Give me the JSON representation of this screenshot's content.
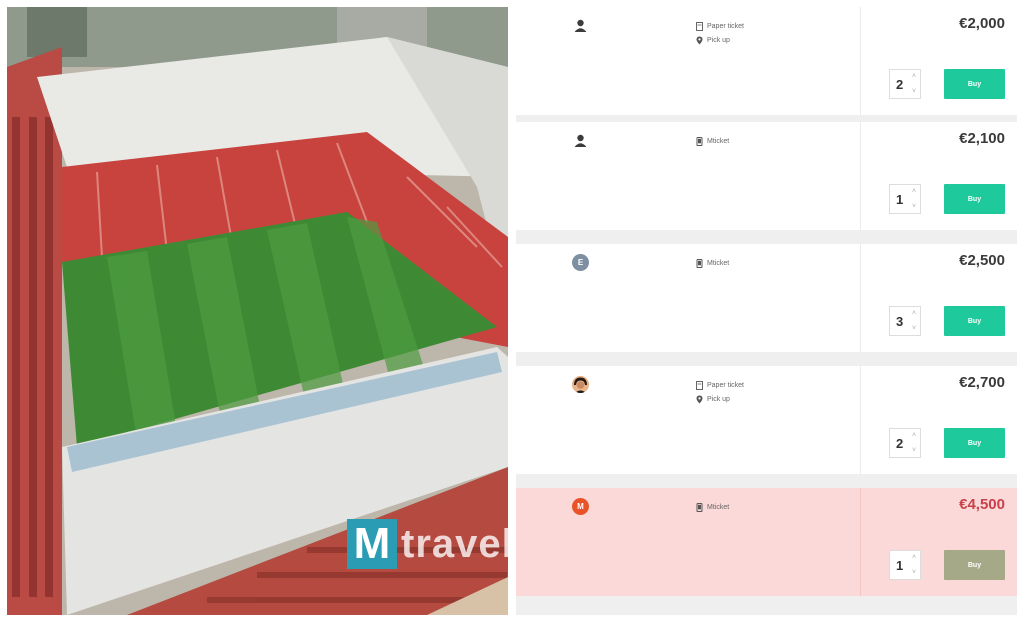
{
  "photo": {
    "logo_letter": "M",
    "logo_text": "travel"
  },
  "colors": {
    "buy_active": "#1ec99b",
    "buy_disabled": "#a6a988",
    "highlight_row": "#fbd9d8",
    "highlight_price": "#c9414a",
    "logo_bg": "#2a9cb4"
  },
  "listings": [
    {
      "avatar": "user-silhouette-icon",
      "delivery": [
        {
          "icon": "ticket-icon",
          "text": "Paper ticket"
        },
        {
          "icon": "location-pin-icon",
          "text": "Pick up"
        }
      ],
      "price": "€2,000",
      "quantity": "2",
      "buy_label": "Buy",
      "highlight": false
    },
    {
      "avatar": "user-silhouette-icon",
      "delivery": [
        {
          "icon": "mobile-phone-icon",
          "text": "Mticket"
        }
      ],
      "price": "€2,100",
      "quantity": "1",
      "buy_label": "Buy",
      "highlight": false
    },
    {
      "avatar": "letter-avatar",
      "avatar_letter": "E",
      "delivery": [
        {
          "icon": "mobile-phone-icon",
          "text": "Mticket"
        }
      ],
      "price": "€2,500",
      "quantity": "3",
      "buy_label": "Buy",
      "highlight": false
    },
    {
      "avatar": "profile-photo",
      "delivery": [
        {
          "icon": "ticket-icon",
          "text": "Paper ticket"
        },
        {
          "icon": "location-pin-icon",
          "text": "Pick up"
        }
      ],
      "price": "€2,700",
      "quantity": "2",
      "buy_label": "Buy",
      "highlight": false
    },
    {
      "avatar": "letter-avatar",
      "avatar_letter": "M",
      "delivery": [
        {
          "icon": "mobile-phone-icon",
          "text": "Mticket"
        }
      ],
      "price": "€4,500",
      "quantity": "1",
      "buy_label": "Buy",
      "highlight": true
    }
  ]
}
